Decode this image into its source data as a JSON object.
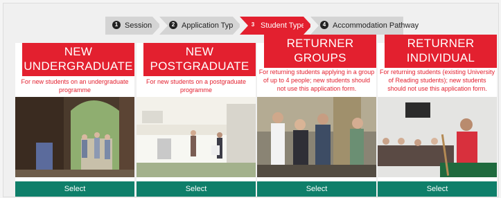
{
  "stepper": {
    "steps": [
      {
        "num": "1",
        "label": "Session"
      },
      {
        "num": "2",
        "label": "Application Type"
      },
      {
        "num": "3",
        "label": "Student Type"
      },
      {
        "num": "4",
        "label": "Accommodation Pathway"
      }
    ],
    "active_index": 2
  },
  "cards": [
    {
      "title_line1": "NEW",
      "title_line2": "UNDERGRADUATE",
      "description_line1": "For new students on an undergraduate",
      "description_line2": "programme",
      "description_line3": "",
      "button": "Select",
      "photo": "university-gateway-students"
    },
    {
      "title_line1": "NEW",
      "title_line2": "POSTGRADUATE",
      "description_line1": "For new students on a postgraduate",
      "description_line2": "programme",
      "description_line3": "",
      "button": "Select",
      "photo": "shared-kitchen"
    },
    {
      "title_line1": "RETURNER",
      "title_line2": "GROUPS",
      "description_line1": "For returning students applying in a group",
      "description_line2": "of up to 4 people; new students should",
      "description_line3": "not use this application form.",
      "button": "Select",
      "photo": "group-of-students"
    },
    {
      "title_line1": "RETURNER",
      "title_line2": "INDIVIDUAL",
      "description_line1": "For returning students (existing University",
      "description_line2": "of Reading students); new students",
      "description_line3": "should not use this application form.",
      "button": "Select",
      "photo": "common-room-pool-table"
    }
  ],
  "colors": {
    "accent_red": "#e3202f",
    "select_green": "#0f7f6a",
    "step_grey": "#d4d4d4"
  }
}
